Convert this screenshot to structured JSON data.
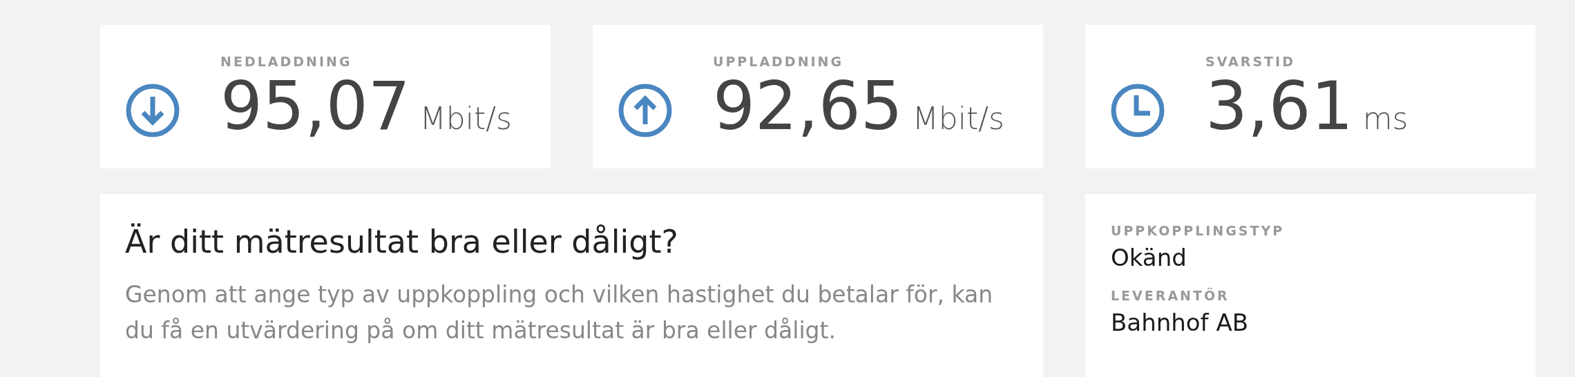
{
  "metrics": [
    {
      "kind": "download",
      "label": "NEDLADDNING",
      "value": "95,07",
      "unit": "Mbit/s"
    },
    {
      "kind": "upload",
      "label": "UPPLADDNING",
      "value": "92,65",
      "unit": "Mbit/s"
    },
    {
      "kind": "clock",
      "label": "SVARSTID",
      "value": "3,61",
      "unit": "ms"
    }
  ],
  "evaluation": {
    "heading": "Är ditt mätresultat bra eller dåligt?",
    "text": "Genom att ange typ av uppkoppling och vilken hastighet du betalar för, kan du få en utvärdering på om ditt mätresultat är bra eller dåligt."
  },
  "details": [
    {
      "label": "UPPKOPPLINGSTYP",
      "value": "Okänd"
    },
    {
      "label": "LEVERANTÖR",
      "value": "Bahnhof AB"
    }
  ]
}
